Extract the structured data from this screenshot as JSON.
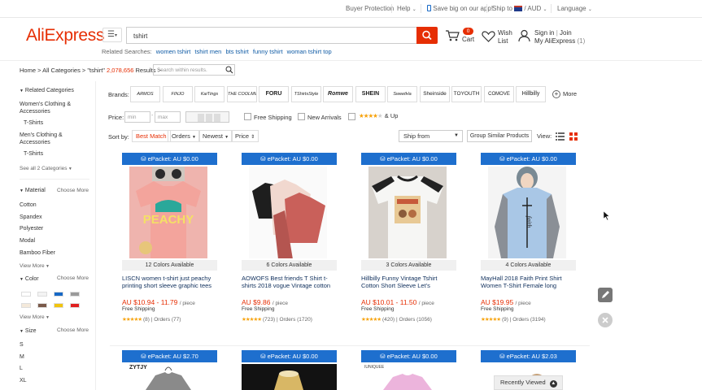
{
  "topbar": {
    "buyer_protection": "Buyer Protection",
    "help": "Help",
    "save_app": "Save big on our app!",
    "ship_to": "Ship to",
    "currency": "/ AUD",
    "language": "Language"
  },
  "header": {
    "logo": "AliExpress",
    "search_value": "tshirt",
    "related_label": "Related Searches:",
    "related": [
      "women tshirt",
      "tshirt men",
      "bts tshirt",
      "funny tshirt",
      "woman tshirt top"
    ],
    "cart_count": "0",
    "cart_label": "Cart",
    "wish_label": "Wish",
    "wish_label2": "List",
    "signin": "Sign in",
    "join": "Join",
    "my_aliexpress": "My AliExpress",
    "my_count": "(1)"
  },
  "breadcrumb": {
    "path": "Home > All Categories > \"tshirt\"",
    "count": "2,078,656",
    "results": "Results >",
    "within_placeholder": "Search within results."
  },
  "sidebar": {
    "related_title": "Related Categories",
    "cat1": "Women's Clothing &",
    "cat1b": "Accessories",
    "cat1_sub": "T-Shirts",
    "cat2": "Men's Clothing &",
    "cat2b": "Accessories",
    "cat2_sub": "T-Shirts",
    "see_all": "See all 2 Categories",
    "material_title": "Material",
    "choose_more": "Choose More",
    "materials": [
      "Cotton",
      "Spandex",
      "Polyester",
      "Modal",
      "Bamboo Fiber"
    ],
    "view_more": "View More",
    "color_title": "Color",
    "colors": [
      "#ffffff",
      "#f3f3f3",
      "#1769c6",
      "#9a9a9a",
      "#f4e9da",
      "#7a5a4a",
      "#f1c40f",
      "#e02020"
    ],
    "size_title": "Size",
    "sizes": [
      "S",
      "M",
      "L",
      "XL"
    ]
  },
  "filters": {
    "brands_label": "Brands:",
    "brands": [
      "ARMOS",
      "FINJO",
      "KaiTings",
      "THE COOLMIND",
      "FORU",
      "TShirtsStyle",
      "Romwe",
      "SHEIN",
      "SweetHa",
      "Sheinside",
      "TOYOUTH",
      "COMOVE",
      "Hillbilly"
    ],
    "more": "More",
    "price_label": "Price:",
    "min": "min",
    "max": "max",
    "free_shipping": "Free Shipping",
    "new_arrivals": "New Arrivals",
    "and_up": "& Up",
    "sort_label": "Sort by:",
    "sort_options": [
      "Best Match",
      "Orders",
      "Newest",
      "Price"
    ],
    "ship_from": "Ship from",
    "group_similar": "Group Similar Products",
    "view_label": "View:"
  },
  "products": [
    {
      "epacket": "ePacket: AU $0.00",
      "colors": "12 Colors Available",
      "title1": "LISCN women t-shirt just peachy",
      "title2": "printing short sleeve graphic tees",
      "price": "AU $10.94 - 11.79",
      "per": "/ piece",
      "shipping": "Free Shipping",
      "rating": "(8)",
      "orders": "Orders (77)"
    },
    {
      "epacket": "ePacket: AU $0.00",
      "colors": "6 Colors Available",
      "title1": "AOWOFS Best friends T Shirt t-",
      "title2": "shirts 2018 vogue Vintage cotton",
      "price": "AU $9.86",
      "per": "/ piece",
      "shipping": "Free Shipping",
      "rating": "(723)",
      "orders": "Orders (1720)"
    },
    {
      "epacket": "ePacket: AU $0.00",
      "colors": "3 Colors Available",
      "title1": "Hillbilly Funny Vintage Tshirt",
      "title2": "Cotton Short Sleeve Let's",
      "price": "AU $10.01 - 11.50",
      "per": "/ piece",
      "shipping": "Free Shipping",
      "rating": "(420)",
      "orders": "Orders (1056)"
    },
    {
      "epacket": "ePacket: AU $0.00",
      "colors": "4 Colors Available",
      "title1": "MayHall 2018 Faith Print Shirt",
      "title2": "Women T-Shirt Female long",
      "price": "AU $19.95",
      "per": "/ piece",
      "shipping": "Free Shipping",
      "rating": "(9)",
      "orders": "Orders (3194)"
    }
  ],
  "products_row2": [
    {
      "epacket": "ePacket: AU $2.70",
      "brand": "ZYTJY"
    },
    {
      "epacket": "ePacket: AU $0.00"
    },
    {
      "epacket": "ePacket: AU $0.00",
      "brand": "IUNIQUEE"
    },
    {
      "epacket": "ePacket: AU $2.03"
    }
  ],
  "recently_viewed": "Recently Viewed",
  "product_images": {
    "peachy_text": "PEACHY",
    "faith_text": "faith"
  }
}
